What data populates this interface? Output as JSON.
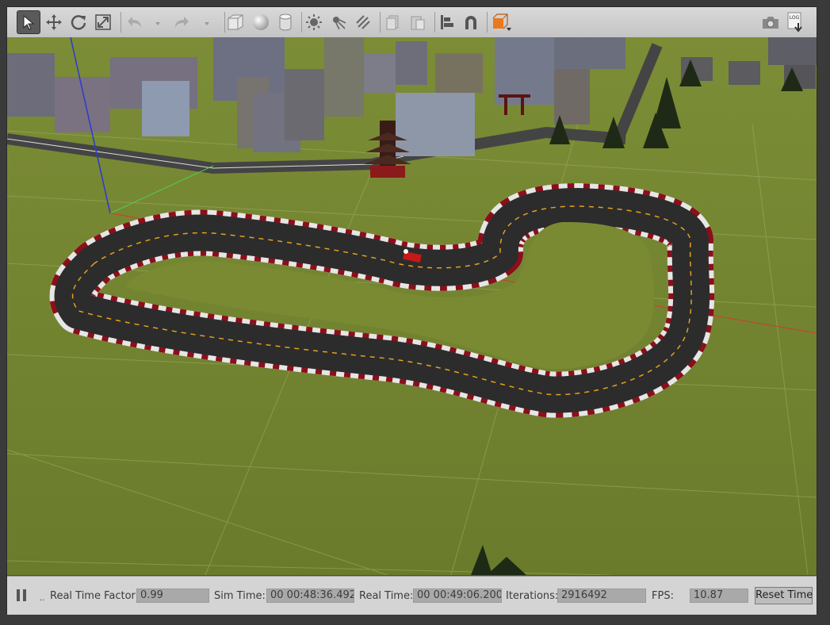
{
  "toolbar": {
    "tools": [
      {
        "name": "select-mode",
        "icon": "arrow-cursor-icon",
        "active": true
      },
      {
        "name": "translate-mode",
        "icon": "move-arrows-icon"
      },
      {
        "name": "rotate-mode",
        "icon": "rotate-icon"
      },
      {
        "name": "scale-mode",
        "icon": "scale-icon"
      },
      {
        "name": "undo",
        "icon": "undo-icon"
      },
      {
        "name": "redo",
        "icon": "redo-icon"
      },
      {
        "name": "box-shape",
        "icon": "box-icon"
      },
      {
        "name": "sphere-shape",
        "icon": "sphere-icon"
      },
      {
        "name": "cylinder-shape",
        "icon": "cylinder-icon"
      },
      {
        "name": "point-light",
        "icon": "sun-icon"
      },
      {
        "name": "spot-light",
        "icon": "spotlight-icon"
      },
      {
        "name": "directional-light",
        "icon": "directional-light-icon"
      },
      {
        "name": "copy",
        "icon": "copy-icon"
      },
      {
        "name": "paste",
        "icon": "paste-icon"
      },
      {
        "name": "align",
        "icon": "align-icon"
      },
      {
        "name": "snap",
        "icon": "magnet-icon"
      },
      {
        "name": "view-angle",
        "icon": "view-angle-icon"
      },
      {
        "name": "screenshot",
        "icon": "camera-icon"
      },
      {
        "name": "log",
        "icon": "log-icon"
      }
    ],
    "log_label": "LOG",
    "accent_color": "#e8791e"
  },
  "status": {
    "rtf_label": "Real Time Factor:",
    "rtf_value": "0.99",
    "sim_label": "Sim Time:",
    "sim_value": "00 00:48:36.492",
    "real_label": "Real Time:",
    "real_value": "00 00:49:06.200",
    "iter_label": "Iterations:",
    "iter_value": "2916492",
    "fps_label": "FPS:",
    "fps_value": "10.87",
    "reset_label": "Reset Time"
  },
  "scene": {
    "ground_color": "#6b7d2e",
    "track_color": "#2c2c2c",
    "centerline_color": "#e3a21a",
    "curb_red": "#8b0f1a",
    "curb_white": "#e6e6e6"
  }
}
